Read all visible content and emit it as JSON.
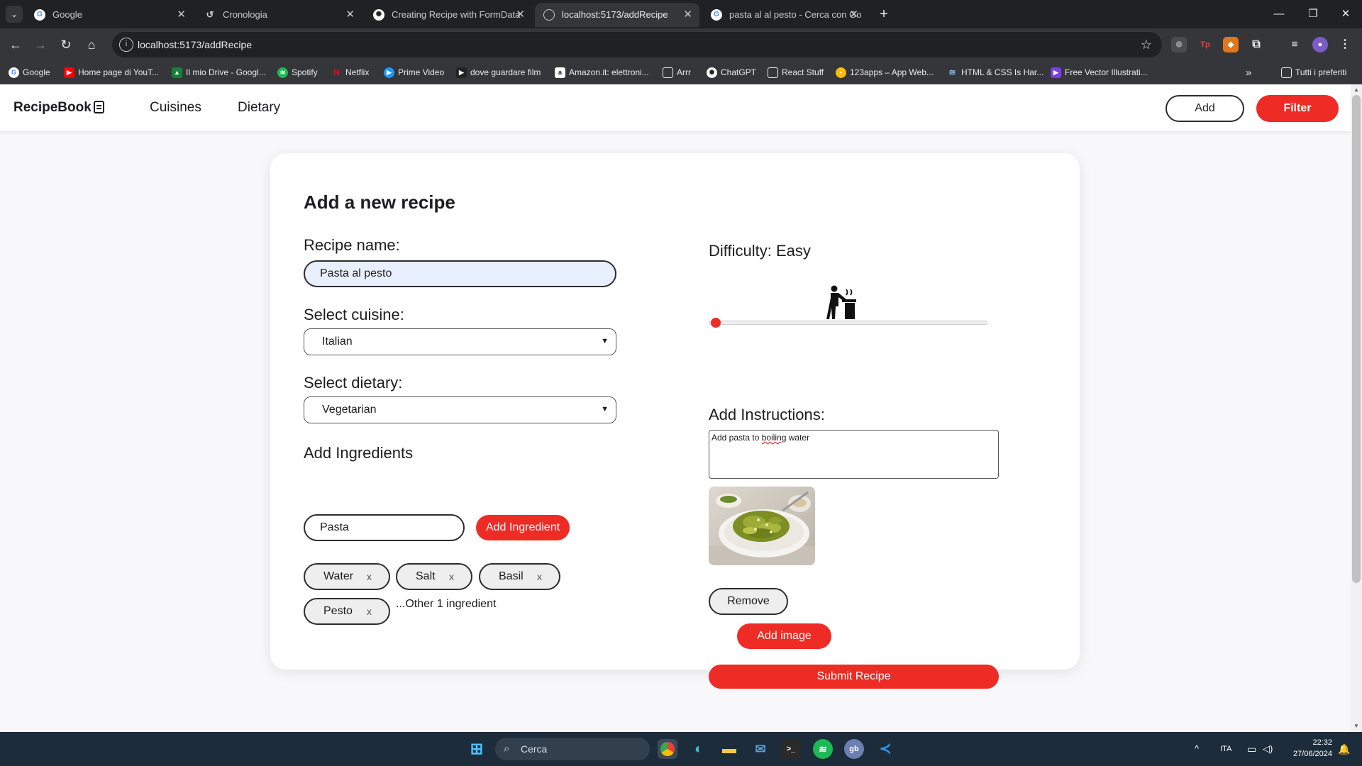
{
  "browser": {
    "tabs": [
      {
        "title": "Google",
        "active": false
      },
      {
        "title": "Cronologia",
        "active": false
      },
      {
        "title": "Creating Recipe with FormData",
        "active": false
      },
      {
        "title": "localhost:5173/addRecipe",
        "active": true
      },
      {
        "title": "pasta al al pesto - Cerca con Go",
        "active": false
      }
    ],
    "url": "localhost:5173/addRecipe",
    "bookmarks": [
      "Google",
      "Home page di YouT...",
      "Il mio Drive - Googl...",
      "Spotify",
      "Netflix",
      "Prime Video",
      "dove guardare film",
      "Amazon.it: elettroni...",
      "Arrr",
      "ChatGPT",
      "React Stuff",
      "123apps – App Web...",
      "HTML & CSS Is Har...",
      "Free Vector Illustrati..."
    ],
    "bookmarks_all": "Tutti i preferiti",
    "extensions": [
      "Tp"
    ]
  },
  "app": {
    "brand": "RecipeBook",
    "nav": {
      "cuisines": "Cuisines",
      "dietary": "Dietary"
    },
    "add_label": "Add",
    "filter_label": "Filter"
  },
  "form": {
    "title": "Add a new recipe",
    "recipe_name_label": "Recipe name:",
    "recipe_name_value": "Pasta al pesto",
    "cuisine_label": "Select cuisine:",
    "cuisine_value": "Italian",
    "dietary_label": "Select dietary:",
    "dietary_value": "Vegetarian",
    "ingredients_label": "Add Ingredients",
    "ingredient_input_value": "Pasta",
    "add_ingredient_label": "Add Ingredient",
    "ingredients": [
      "Water",
      "Salt",
      "Basil",
      "Pesto"
    ],
    "ingredient_remove": "x",
    "more_ingredients": "...Other 1 ingredient",
    "difficulty_label": "Difficulty: Easy",
    "difficulty_level": 0,
    "instructions_label": "Add Instructions:",
    "instructions_plain1": "Add pasta to ",
    "instructions_misspelled": "boiling",
    "instructions_plain2": " water",
    "remove_label": "Remove",
    "add_image_label": "Add image",
    "submit_label": "Submit Recipe"
  },
  "taskbar": {
    "search_placeholder": "Cerca",
    "language": "ITA",
    "time": "22:32",
    "date": "27/06/2024"
  },
  "colors": {
    "accent": "#ee2b24",
    "dark": "#1d1d1f",
    "page_bg": "#f8f8fa"
  }
}
